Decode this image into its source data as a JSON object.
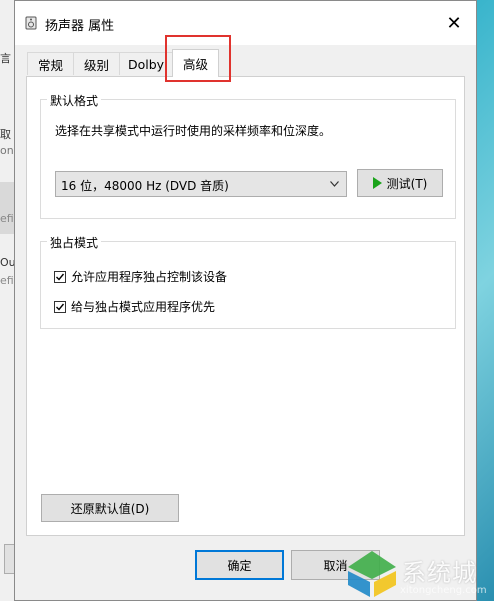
{
  "background_window": {
    "fragments": [
      "言",
      "取",
      "on",
      "efi",
      "Ou",
      "efi"
    ]
  },
  "dialog": {
    "title": "扬声器 属性",
    "close_glyph": "✕"
  },
  "tabs": [
    {
      "label": "常规"
    },
    {
      "label": "级别"
    },
    {
      "label": "Dolby"
    },
    {
      "label": "高级"
    }
  ],
  "default_format": {
    "group_label": "默认格式",
    "description": "选择在共享模式中运行时使用的采样频率和位深度。",
    "selected_format": "16 位，48000 Hz (DVD 音质)",
    "test_label": "测试(T)"
  },
  "exclusive_mode": {
    "group_label": "独占模式",
    "options": [
      {
        "label": "允许应用程序独占控制该设备",
        "checked": true
      },
      {
        "label": "给与独占模式应用程序优先",
        "checked": true
      }
    ]
  },
  "restore_defaults_label": "还原默认值(D)",
  "footer": {
    "ok_label": "确定",
    "cancel_label": "取消"
  },
  "watermark": {
    "text": "系统城",
    "url": "xitongcheng.com"
  },
  "colors": {
    "highlight": "#e0332e",
    "play": "#1aa31a",
    "default_button_border": "#0078d7"
  }
}
